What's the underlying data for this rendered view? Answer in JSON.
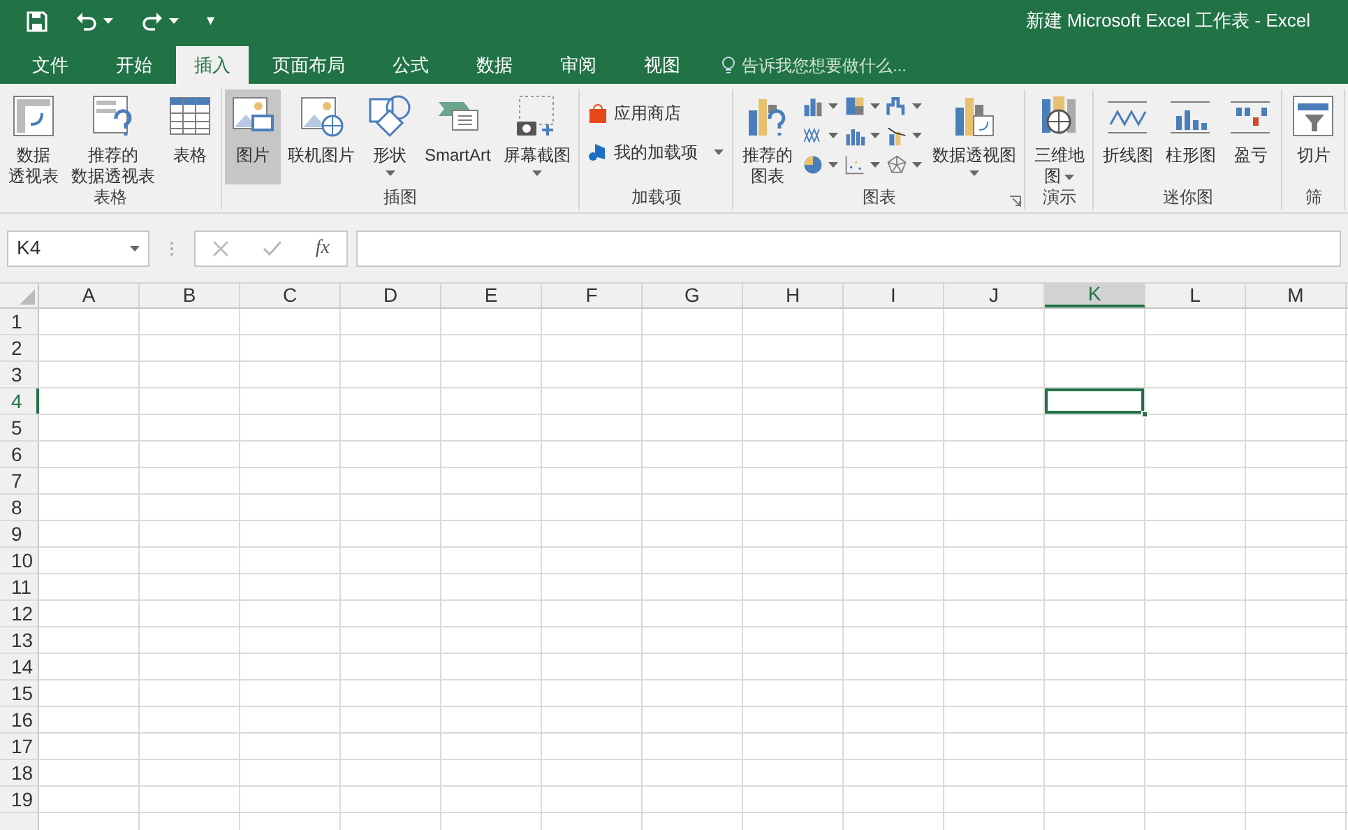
{
  "window": {
    "title": "新建 Microsoft Excel 工作表 - Excel"
  },
  "quick_access": {
    "customize_glyph": "▾"
  },
  "tabs": [
    {
      "label": "文件",
      "selected": false
    },
    {
      "label": "开始",
      "selected": false
    },
    {
      "label": "插入",
      "selected": true
    },
    {
      "label": "页面布局",
      "selected": false
    },
    {
      "label": "公式",
      "selected": false
    },
    {
      "label": "数据",
      "selected": false
    },
    {
      "label": "审阅",
      "selected": false
    },
    {
      "label": "视图",
      "selected": false
    }
  ],
  "tell_me": {
    "placeholder": "告诉我您想要做什么..."
  },
  "ribbon_groups": [
    {
      "label": "表格",
      "buttons": [
        {
          "kind": "large",
          "lines": [
            "数据",
            "透视表"
          ],
          "selected": false,
          "dropdown": false
        },
        {
          "kind": "large",
          "lines": [
            "推荐的",
            "数据透视表"
          ],
          "selected": false,
          "dropdown": false
        },
        {
          "kind": "large",
          "lines": [
            "表格"
          ],
          "selected": false,
          "dropdown": false
        }
      ]
    },
    {
      "label": "插图",
      "buttons": [
        {
          "kind": "large",
          "lines": [
            "图片"
          ],
          "selected": true,
          "dropdown": false
        },
        {
          "kind": "large",
          "lines": [
            "联机图片"
          ],
          "selected": false,
          "dropdown": false
        },
        {
          "kind": "large",
          "lines": [
            "形状"
          ],
          "selected": false,
          "dropdown": true
        },
        {
          "kind": "large",
          "lines": [
            "SmartArt"
          ],
          "selected": false,
          "dropdown": false
        },
        {
          "kind": "large",
          "lines": [
            "屏幕截图"
          ],
          "selected": false,
          "dropdown": true
        }
      ]
    },
    {
      "label": "加载项",
      "buttons": [
        {
          "kind": "small",
          "label": "应用商店",
          "selected": false,
          "dropdown": false
        },
        {
          "kind": "small",
          "label": "我的加载项",
          "selected": false,
          "dropdown": true
        }
      ]
    },
    {
      "label": "图表",
      "launcher": true,
      "buttons": [
        {
          "kind": "large",
          "lines": [
            "推荐的",
            "图表"
          ],
          "selected": false,
          "dropdown": false
        },
        {
          "kind": "gallery",
          "selected": false,
          "dropdown": true
        },
        {
          "kind": "large",
          "lines": [
            "数据透视图"
          ],
          "selected": false,
          "dropdown": true
        }
      ]
    },
    {
      "label": "演示",
      "buttons": [
        {
          "kind": "large",
          "lines": [
            "三维地",
            "图"
          ],
          "selected": false,
          "dropdown": true
        }
      ]
    },
    {
      "label": "迷你图",
      "buttons": [
        {
          "kind": "large",
          "lines": [
            "折线图"
          ],
          "selected": false,
          "dropdown": false
        },
        {
          "kind": "large",
          "lines": [
            "柱形图"
          ],
          "selected": false,
          "dropdown": false
        },
        {
          "kind": "large",
          "lines": [
            "盈亏"
          ],
          "selected": false,
          "dropdown": false
        }
      ]
    },
    {
      "label": "筛",
      "buttons": [
        {
          "kind": "large",
          "lines": [
            "切片"
          ],
          "selected": false,
          "dropdown": false
        }
      ]
    }
  ],
  "formula_bar": {
    "name_box": "K4",
    "function_label": "fx"
  },
  "grid": {
    "columns": [
      {
        "label": "A",
        "selected": false
      },
      {
        "label": "B",
        "selected": false
      },
      {
        "label": "C",
        "selected": false
      },
      {
        "label": "D",
        "selected": false
      },
      {
        "label": "E",
        "selected": false
      },
      {
        "label": "F",
        "selected": false
      },
      {
        "label": "G",
        "selected": false
      },
      {
        "label": "H",
        "selected": false
      },
      {
        "label": "I",
        "selected": false
      },
      {
        "label": "J",
        "selected": false
      },
      {
        "label": "K",
        "selected": true
      },
      {
        "label": "L",
        "selected": false
      },
      {
        "label": "M",
        "selected": false
      }
    ],
    "rows": [
      {
        "label": "1",
        "selected": false
      },
      {
        "label": "2",
        "selected": false
      },
      {
        "label": "3",
        "selected": false
      },
      {
        "label": "4",
        "selected": true
      },
      {
        "label": "5",
        "selected": false
      },
      {
        "label": "6",
        "selected": false
      },
      {
        "label": "7",
        "selected": false
      },
      {
        "label": "8",
        "selected": false
      },
      {
        "label": "9",
        "selected": false
      },
      {
        "label": "10",
        "selected": false
      },
      {
        "label": "11",
        "selected": false
      },
      {
        "label": "12",
        "selected": false
      },
      {
        "label": "13",
        "selected": false
      },
      {
        "label": "14",
        "selected": false
      },
      {
        "label": "15",
        "selected": false
      },
      {
        "label": "16",
        "selected": false
      },
      {
        "label": "17",
        "selected": false
      },
      {
        "label": "18",
        "selected": false
      },
      {
        "label": "19",
        "selected": false
      }
    ]
  }
}
